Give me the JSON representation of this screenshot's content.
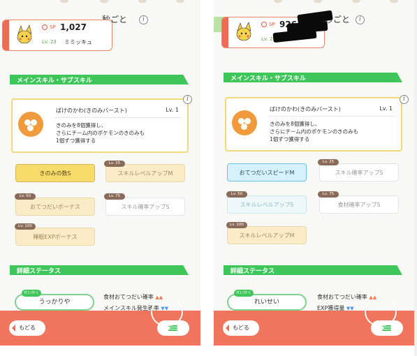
{
  "left": {
    "header_fragment": "秒ごと",
    "pokemon": {
      "sp_label": "SP",
      "sp_value": "1,027",
      "level": "Lv. 23",
      "name": "ミミッキュ"
    },
    "section_skills": "メインスキル・サブスキル",
    "main_skill": {
      "name": "ばけのかわ(きのみバースト)",
      "level": "Lv. 1",
      "description_lines": [
        "きのみを8個獲得し、",
        "さらにチーム内のポケモンのきのみも",
        "1個ずつ獲得する"
      ]
    },
    "sub_skills": [
      {
        "label": "きのみの数S",
        "unlock": ""
      },
      {
        "label": "スキルレベルアップM",
        "unlock": "Lv. 25"
      },
      {
        "label": "おてつだいボーナス",
        "unlock": "Lv. 50"
      },
      {
        "label": "スキル確率アップS",
        "unlock": "Lv. 75"
      },
      {
        "label": "睡眠EXPボーナス",
        "unlock": "Lv. 100"
      }
    ],
    "section_status": "詳細ステータス",
    "nature_label": "せいかく",
    "nature": "うっかりや",
    "stats": [
      {
        "label": "食材おてつだい確率",
        "arrows": "▲▲"
      },
      {
        "label": "メインスキル発生確率",
        "arrows": "▼▼"
      }
    ],
    "back_label": "もどる"
  },
  "right": {
    "header_fragment": "秒ごと",
    "pokemon": {
      "sp_label": "SP",
      "sp_value": "926",
      "level": "Lv. 25",
      "name": ""
    },
    "section_skills": "メインスキル・サブスキル",
    "main_skill": {
      "name": "ばけのかわ(きのみバースト)",
      "level": "Lv. 1",
      "description_lines": [
        "きのみを8個獲得し、",
        "さらにチーム内のポケモンのきのみも",
        "1個ずつ獲得する"
      ]
    },
    "sub_skills": [
      {
        "label": "おてつだいスピードM",
        "unlock": ""
      },
      {
        "label": "スキル確率アップS",
        "unlock": "Lv. 25"
      },
      {
        "label": "スキルレベルアップS",
        "unlock": "Lv. 50"
      },
      {
        "label": "食材確率アップS",
        "unlock": "Lv. 75"
      },
      {
        "label": "スキルレベルアップM",
        "unlock": "Lv. 100"
      }
    ],
    "section_status": "詳細ステータス",
    "nature_label": "せいかく",
    "nature": "れいせい",
    "stats": [
      {
        "label": "食材おてつだい確率",
        "arrows": "▲▲"
      },
      {
        "label": "EXP獲得量",
        "arrows": "▼▼"
      }
    ],
    "back_label": "もどる"
  },
  "colors": {
    "accent_green": "#3fc65a",
    "footer_coral": "#f0755c",
    "card_gold": "#f3d87d"
  }
}
